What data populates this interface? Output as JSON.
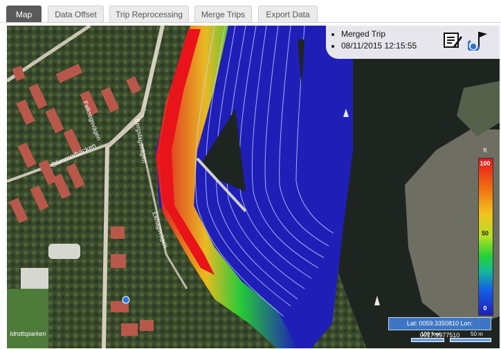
{
  "tabs": [
    {
      "label": "Map",
      "active": true
    },
    {
      "label": "Data Offset",
      "active": false
    },
    {
      "label": "Trip Reprocessing",
      "active": false
    },
    {
      "label": "Merge Trips",
      "active": false
    },
    {
      "label": "Export Data",
      "active": false
    }
  ],
  "info": {
    "trip_name": "Merged Trip",
    "trip_datetime": "08/11/2015 12:15:55",
    "icons": [
      "edit-note-icon",
      "flag-waypoint-icon"
    ]
  },
  "legend": {
    "title": "ft",
    "max_label": "100",
    "mid_label": "50",
    "min_label": "0",
    "colors": [
      "#e8141a",
      "#f3c21c",
      "#25d235",
      "#1360e8",
      "#1f1fb7"
    ]
  },
  "coordinates": {
    "text": "Lat: 0059.3350810 Lon: 0017.9977510"
  },
  "scale": {
    "feet_label": "100 feet",
    "meters_label": "50 m"
  },
  "map_labels": {
    "watermark": "Idrottsparken",
    "street_1": "Glimmerbacken",
    "street_2": "Falkstigsvägen",
    "street_3": "Bergslagsvägen",
    "street_4": "Ekhagsvägen"
  }
}
